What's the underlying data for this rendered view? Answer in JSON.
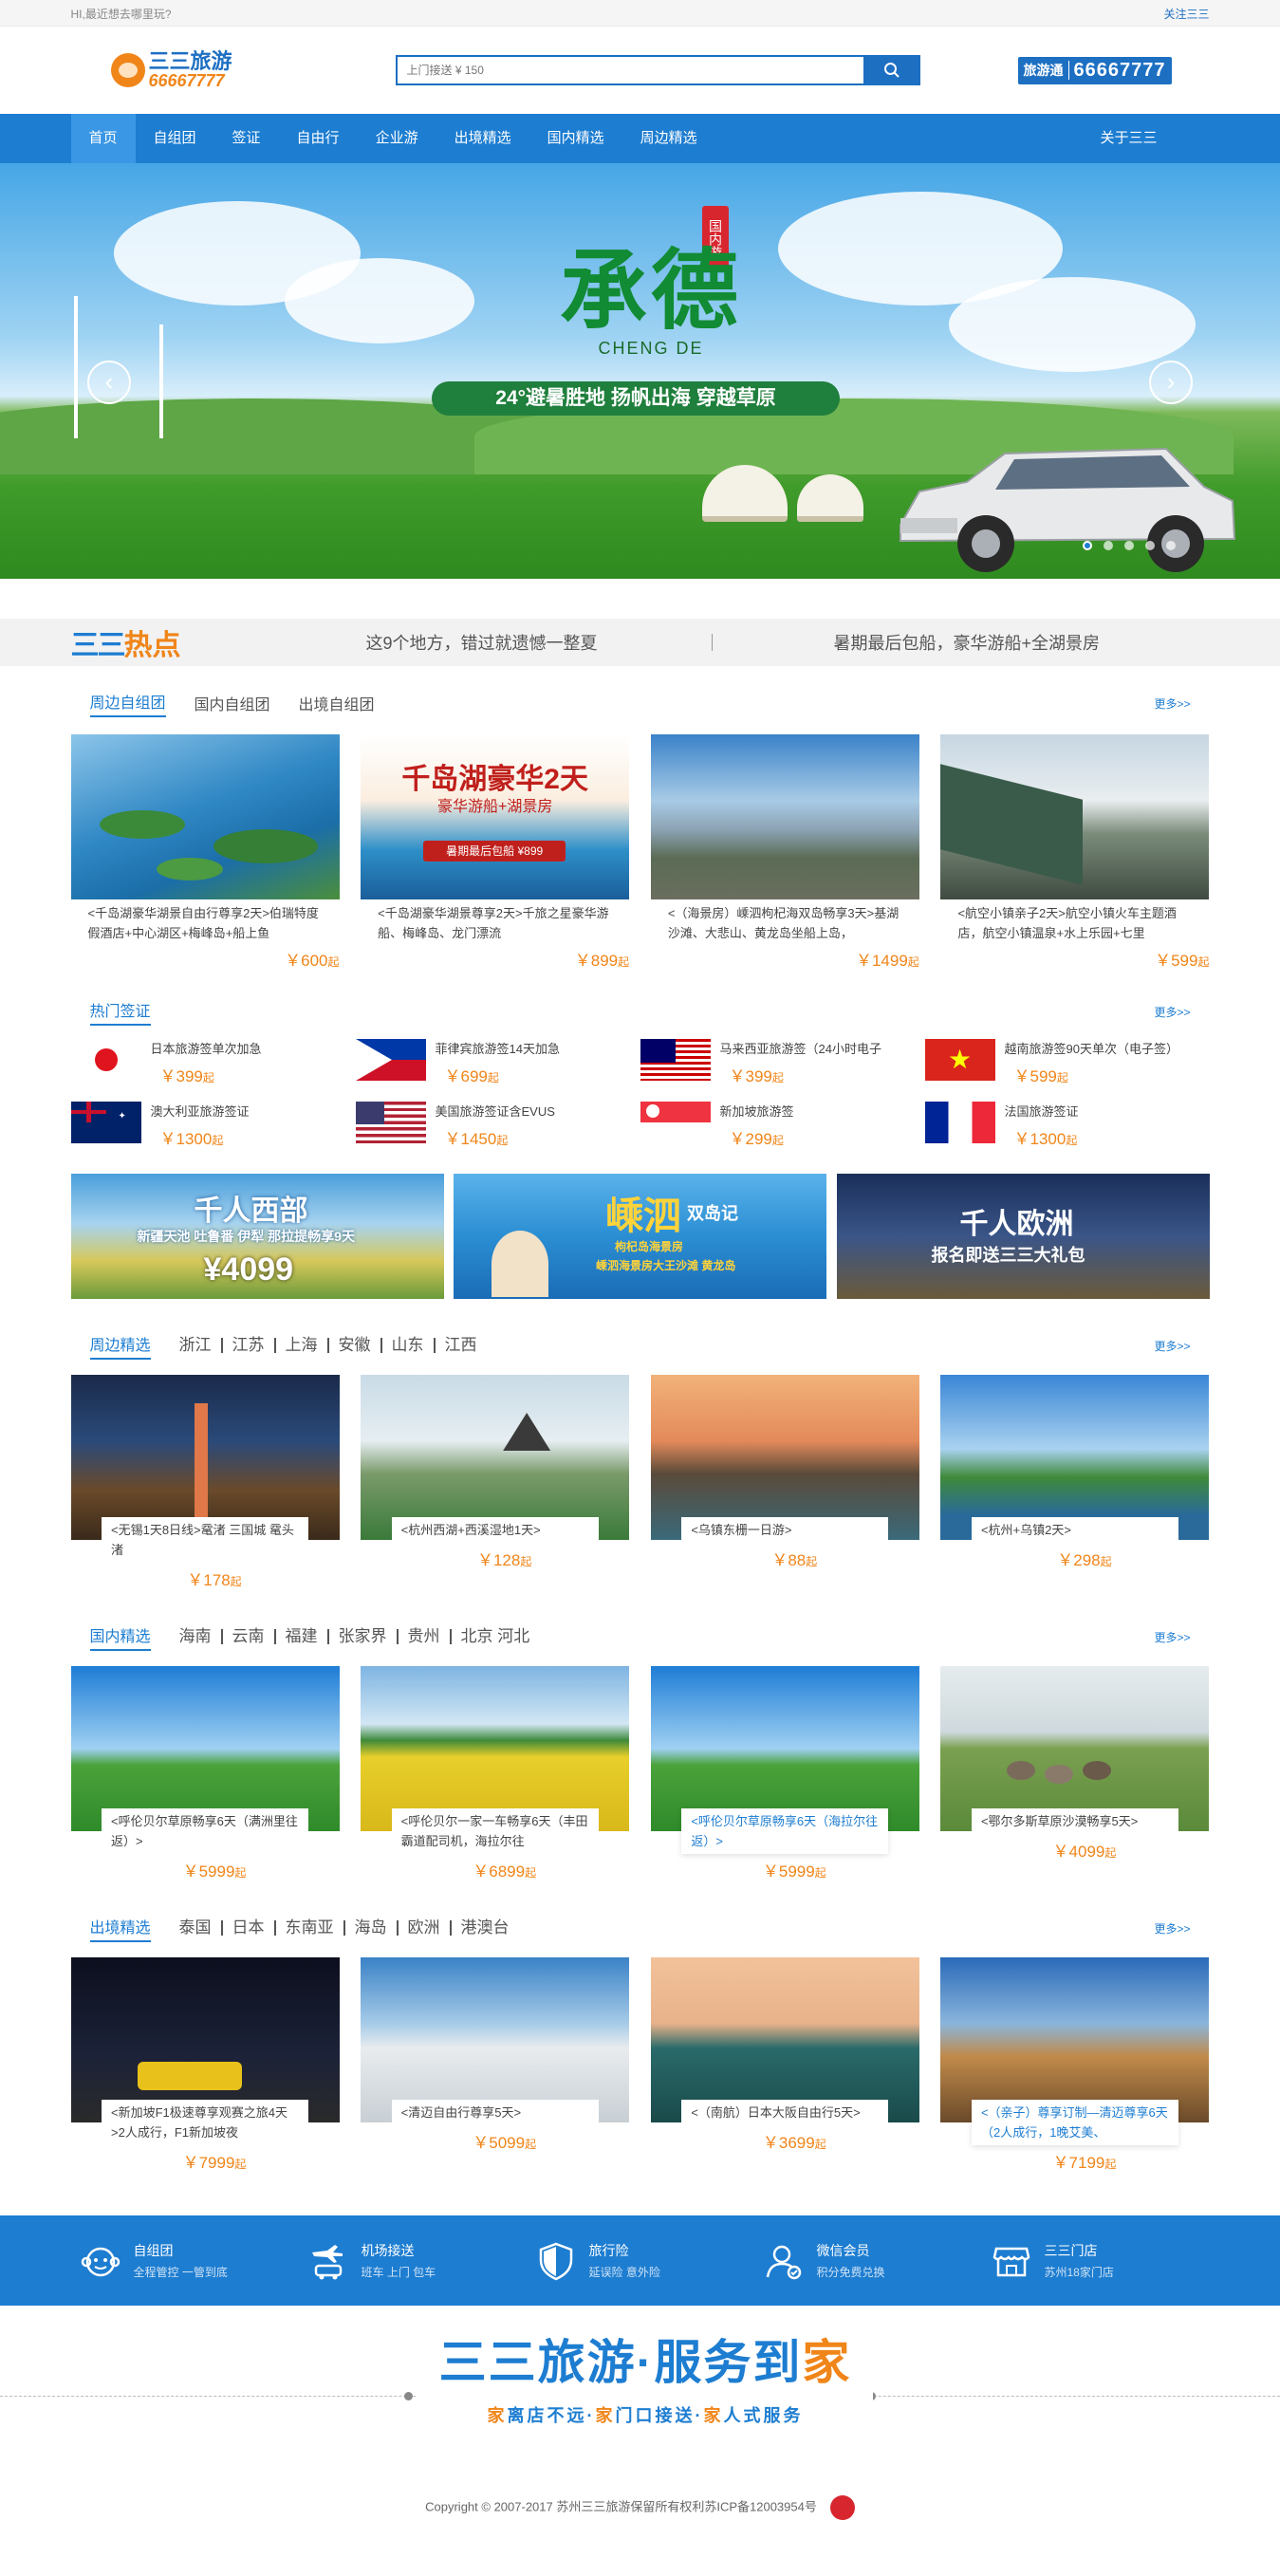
{
  "topbar": {
    "greeting": "HI,最近想去哪里玩?",
    "follow": "关注三三"
  },
  "header": {
    "logo_brand": "三三旅游",
    "logo_tel": "66667777",
    "search_placeholder": "上门接送 ¥ 150",
    "hotline_key": "旅游通",
    "hotline_number": "66667777"
  },
  "nav": {
    "items": [
      "首页",
      "自组团",
      "签证",
      "自由行",
      "企业游",
      "出境精选",
      "国内精选",
      "周边精选"
    ],
    "about": "关于三三"
  },
  "banner": {
    "title_cn": "承德",
    "title_en": "CHENG DE",
    "seal": "国内游",
    "slogan": "24°避暑胜地  扬帆出海  穿越草原",
    "prev": "‹",
    "next": "›"
  },
  "hot": {
    "logo_lines": "三三",
    "logo_word": "热点",
    "slogan1": "这9个地方，错过就遗憾一整夏",
    "slogan2": "暑期最后包船，豪华游船+全湖景房"
  },
  "self_group": {
    "tabs": [
      "周边自组团",
      "国内自组团",
      "出境自组团"
    ],
    "more": "更多>>",
    "cards": [
      {
        "desc": "<千岛湖豪华湖景自由行尊享2天>伯瑞特度假酒店+中心湖区+梅峰岛+船上鱼",
        "price": "￥600",
        "unit": "起"
      },
      {
        "desc": "<千岛湖豪华湖景尊享2天>千旅之星豪华游船、梅峰岛、龙门漂流",
        "price": "￥899",
        "unit": "起",
        "pic_title": "千岛湖豪华2天",
        "pic_sub": "豪华游船+湖景房",
        "pic_tag": "暑期最后包船 ¥899"
      },
      {
        "desc": "<（海景房）嵊泗枸杞海双岛畅享3天>基湖沙滩、大悲山、黄龙岛坐船上岛，",
        "price": "￥1499",
        "unit": "起"
      },
      {
        "desc": "<航空小镇亲子2天>航空小镇火车主题酒店，航空小镇温泉+水上乐园+七里",
        "price": "￥599",
        "unit": "起"
      }
    ]
  },
  "visa": {
    "title": "热门签证",
    "more": "更多>>",
    "items": [
      {
        "name": "日本旅游签单次加急",
        "price": "￥399",
        "unit": "起",
        "flag": "japan"
      },
      {
        "name": "菲律宾旅游签14天加急",
        "price": "￥699",
        "unit": "起",
        "flag": "philippines"
      },
      {
        "name": "马来西亚旅游签（24小时电子",
        "price": "￥399",
        "unit": "起",
        "flag": "malaysia"
      },
      {
        "name": "越南旅游签90天单次（电子签）",
        "price": "￥599",
        "unit": "起",
        "flag": "vietnam"
      },
      {
        "name": "澳大利亚旅游签证",
        "price": "￥1300",
        "unit": "起",
        "flag": "australia"
      },
      {
        "name": "美国旅游签证含EVUS",
        "price": "￥1450",
        "unit": "起",
        "flag": "usa"
      },
      {
        "name": "新加坡旅游签",
        "price": "￥299",
        "unit": "起",
        "flag": "singapore"
      },
      {
        "name": "法国旅游签证",
        "price": "￥1300",
        "unit": "起",
        "flag": "france"
      }
    ]
  },
  "promos": [
    {
      "title": "千人西部",
      "sub": "新疆天池 吐鲁番 伊犁 那拉提畅享9天",
      "price": "¥4099"
    },
    {
      "title": "嵊泗",
      "title2": "双岛记",
      "sub": "枸杞岛海景房",
      "sub2": "嵊泗海景房大王沙滩 黄龙岛"
    },
    {
      "title": "千人欧洲",
      "sub": "报名即送三三大礼包"
    }
  ],
  "nearby": {
    "title": "周边精选",
    "cities": [
      "浙江",
      "江苏",
      "上海",
      "安徽",
      "山东",
      "江西"
    ],
    "more": "更多>>",
    "cards": [
      {
        "cap": "<无锡1天8日线>鼋渚 三国城 鼋头渚",
        "price": "￥178",
        "unit": "起"
      },
      {
        "cap": "<杭州西湖+西溪湿地1天>",
        "price": "￥128",
        "unit": "起"
      },
      {
        "cap": "<乌镇东栅一日游>",
        "price": "￥88",
        "unit": "起"
      },
      {
        "cap": "<杭州+乌镇2天>",
        "price": "￥298",
        "unit": "起"
      }
    ]
  },
  "domestic": {
    "title": "国内精选",
    "cities": [
      "海南",
      "云南",
      "福建",
      "张家界",
      "贵州",
      "北京 河北"
    ],
    "more": "更多>>",
    "cards": [
      {
        "cap": "<呼伦贝尔草原畅享6天（满洲里往返）>",
        "price": "￥5999",
        "unit": "起"
      },
      {
        "cap": "<呼伦贝尔一家一车畅享6天（丰田霸道配司机，海拉尔往",
        "price": "￥6899",
        "unit": "起"
      },
      {
        "cap": "<呼伦贝尔草原畅享6天（海拉尔往返）>",
        "price": "￥5999",
        "unit": "起"
      },
      {
        "cap": "<鄂尔多斯草原沙漠畅享5天>",
        "price": "￥4099",
        "unit": "起"
      }
    ]
  },
  "overseas": {
    "title": "出境精选",
    "cities": [
      "泰国",
      "日本",
      "东南亚",
      "海岛",
      "欧洲",
      "港澳台"
    ],
    "more": "更多>>",
    "cards": [
      {
        "cap": "<新加坡F1极速尊享观赛之旅4天>2人成行，F1新加坡夜",
        "price": "￥7999",
        "unit": "起"
      },
      {
        "cap": "<清迈自由行尊享5天>",
        "price": "￥5099",
        "unit": "起"
      },
      {
        "cap": "<（南航）日本大阪自由行5天>",
        "price": "￥3699",
        "unit": "起"
      },
      {
        "cap": "<（亲子）尊享订制—清迈尊享6天（2人成行，1晚艾美、",
        "price": "￥7199",
        "unit": "起"
      }
    ]
  },
  "services": [
    {
      "t1": "自组团",
      "t2": "全程管控 一管到底",
      "icon": "monkey-icon"
    },
    {
      "t1": "机场接送",
      "t2": "班车  上门  包车",
      "icon": "plane-car-icon"
    },
    {
      "t1": "旅行险",
      "t2": "延误险  意外险",
      "icon": "shield-icon"
    },
    {
      "t1": "微信会员",
      "t2": "积分免费兑换",
      "icon": "member-icon"
    },
    {
      "t1": "三三门店",
      "t2": "苏州18家门店",
      "icon": "store-icon"
    }
  ],
  "footer": {
    "brand": "三三旅游",
    "dot": "·",
    "serve": "服务到",
    "home": "家",
    "sub": [
      "家",
      "离店不远·",
      "家",
      "门口接送·",
      "家",
      "人式服务"
    ],
    "copyright": "Copyright © 2007-2017 苏州三三旅游保留所有权利苏ICP备12003954号"
  },
  "colors": {
    "brand_blue": "#1d7dd1",
    "accent_orange": "#f08519"
  }
}
